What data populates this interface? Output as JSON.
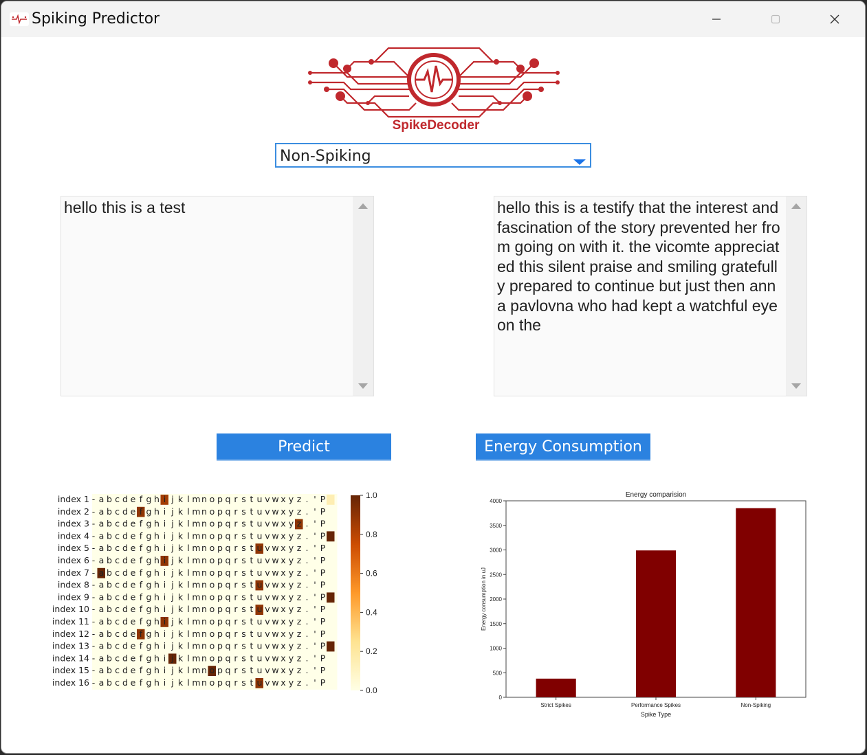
{
  "window": {
    "title": "Spiking Predictor",
    "icon": "app-spike-icon",
    "controls": [
      "minimize-icon",
      "maximize-icon",
      "close-icon"
    ]
  },
  "logo": {
    "caption": "SpikeDecoder",
    "color": "#c0282d"
  },
  "mode_select": {
    "selected": "Non-Spiking"
  },
  "input_text": "hello this is a test",
  "output_text": "hello this is a testify that the interest and fascination of the story prevented her from going on with it. the vicomte appreciated this silent praise and smiling gratefully prepared to continue but just then anna pavlovna who had kept a watchful eye on the",
  "buttons": {
    "predict": "Predict",
    "energy": "Energy Consumption"
  },
  "colors": {
    "accent": "#2b82e0",
    "bar": "#800000",
    "brand_red": "#c0282d"
  },
  "chart_data": [
    {
      "type": "heatmap",
      "rows": [
        "index 1",
        "index 2",
        "index 3",
        "index 4",
        "index 5",
        "index 6",
        "index 7",
        "index 8",
        "index 9",
        "index 10",
        "index 11",
        "index 12",
        "index 13",
        "index 14",
        "index 15",
        "index 16"
      ],
      "columns": [
        "-",
        "a",
        "b",
        "c",
        "d",
        "e",
        "f",
        "g",
        "h",
        "i",
        "j",
        "k",
        "l",
        "m",
        "n",
        "o",
        "p",
        "q",
        "r",
        "s",
        "t",
        "u",
        "v",
        "w",
        "x",
        "y",
        "z",
        ".",
        "'",
        "P"
      ],
      "highlights": [
        {
          "row": 0,
          "col": 9,
          "value": 0.85
        },
        {
          "row": 0,
          "col": 30,
          "value": 0.15
        },
        {
          "row": 1,
          "col": 6,
          "value": 0.9
        },
        {
          "row": 2,
          "col": 26,
          "value": 0.9
        },
        {
          "row": 3,
          "col": 30,
          "value": 1.0
        },
        {
          "row": 4,
          "col": 21,
          "value": 0.9
        },
        {
          "row": 5,
          "col": 9,
          "value": 0.9
        },
        {
          "row": 6,
          "col": 1,
          "value": 1.0
        },
        {
          "row": 7,
          "col": 21,
          "value": 0.9
        },
        {
          "row": 8,
          "col": 30,
          "value": 1.0
        },
        {
          "row": 9,
          "col": 21,
          "value": 0.9
        },
        {
          "row": 10,
          "col": 9,
          "value": 0.9
        },
        {
          "row": 11,
          "col": 6,
          "value": 0.9
        },
        {
          "row": 12,
          "col": 30,
          "value": 1.0
        },
        {
          "row": 13,
          "col": 10,
          "value": 1.0
        },
        {
          "row": 14,
          "col": 15,
          "value": 1.0
        },
        {
          "row": 15,
          "col": 21,
          "value": 0.9
        }
      ],
      "colorbar": {
        "ticks": [
          "0.0",
          "0.2",
          "0.4",
          "0.6",
          "0.8",
          "1.0"
        ],
        "range": [
          0,
          1
        ]
      }
    },
    {
      "type": "bar",
      "title": "Energy comparision",
      "xlabel": "Spike Type",
      "ylabel": "Energy consumption in uJ",
      "categories": [
        "Strict Spikes",
        "Performance Spikes",
        "Non-Spiking"
      ],
      "values": [
        380,
        2990,
        3850
      ],
      "ylim": [
        0,
        4000
      ],
      "yticks": [
        0,
        500,
        1000,
        1500,
        2000,
        2500,
        3000,
        3500,
        4000
      ],
      "grid": false
    }
  ]
}
